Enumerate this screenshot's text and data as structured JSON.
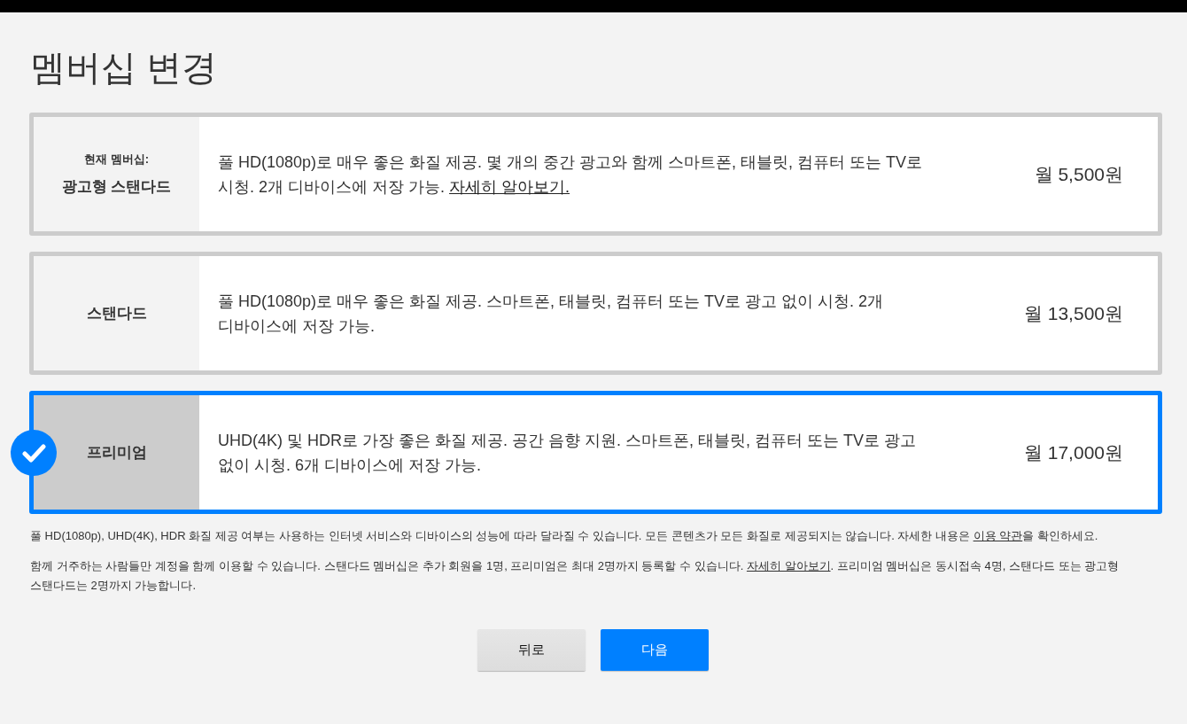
{
  "page": {
    "title": "멤버십 변경"
  },
  "plans": [
    {
      "current_label": "현재 멤버십:",
      "name": "광고형 스탠다드",
      "description": "풀 HD(1080p)로 매우 좋은 화질 제공. 몇 개의 중간 광고와 함께 스마트폰, 태블릿, 컴퓨터 또는 TV로 시청. 2개 디바이스에 저장 가능.",
      "link": "자세히 알아보기.",
      "price": "월 5,500원",
      "selected": false
    },
    {
      "name": "스탠다드",
      "description": "풀 HD(1080p)로 매우 좋은 화질 제공. 스마트폰, 태블릿, 컴퓨터 또는 TV로 광고 없이 시청. 2개 디바이스에 저장 가능.",
      "price": "월 13,500원",
      "selected": false
    },
    {
      "name": "프리미엄",
      "description": "UHD(4K) 및 HDR로 가장 좋은 화질 제공. 공간 음향 지원. 스마트폰, 태블릿, 컴퓨터 또는 TV로 광고 없이 시청. 6개 디바이스에 저장 가능.",
      "price": "월 17,000원",
      "selected": true
    }
  ],
  "notes": [
    {
      "text_before": "풀 HD(1080p), UHD(4K), HDR 화질 제공 여부는 사용하는 인터넷 서비스와 디바이스의 성능에 따라 달라질 수 있습니다. 모든 콘텐츠가 모든 화질로 제공되지는 않습니다. 자세한 내용은",
      "link": "이용 약관",
      "text_after": "을 확인하세요."
    },
    {
      "text_before": "함께 거주하는 사람들만 계정을 함께 이용할 수 있습니다. 스탠다드 멤버십은 추가 회원을 1명, 프리미엄은 최대 2명까지 등록할 수 있습니다.",
      "link": "자세히 알아보기",
      "text_after": ". 프리미엄 멤버십은 동시접속 4명, 스탠다드 또는 광고형 스탠다드는 2명까지 가능합니다."
    }
  ],
  "buttons": [
    {
      "label": "뒤로",
      "kind": "secondary"
    },
    {
      "label": "다음",
      "kind": "primary"
    }
  ]
}
